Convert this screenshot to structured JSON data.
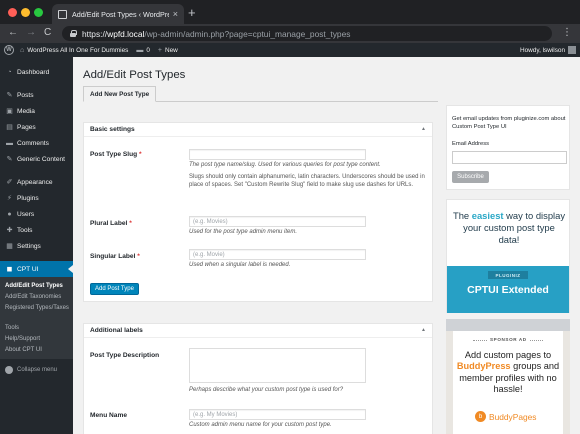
{
  "browser": {
    "tab_title": "Add/Edit Post Types ‹ WordPre…",
    "tab_close": "×",
    "new_tab": "+",
    "back": "←",
    "forward": "→",
    "reload": "C",
    "url_scheme": "https://",
    "url_host": "wpfd.local",
    "url_path": "/wp-admin/admin.php?page=cptui_manage_post_types",
    "menu": "⋮"
  },
  "adminbar": {
    "logo": "W",
    "site_name": "WordPress All In One For Dummies",
    "comments_count": "0",
    "new_label": "New",
    "howdy": "Howdy, lswilson"
  },
  "sidebar": {
    "items": [
      {
        "label": "Dashboard",
        "icon": "dashboard-icon",
        "glyph": "◔"
      },
      {
        "label": "Posts",
        "icon": "pin-icon",
        "glyph": "✎"
      },
      {
        "label": "Media",
        "icon": "media-icon",
        "glyph": "▣"
      },
      {
        "label": "Pages",
        "icon": "pages-icon",
        "glyph": "▤"
      },
      {
        "label": "Comments",
        "icon": "comments-icon",
        "glyph": "▬"
      },
      {
        "label": "Generic Content",
        "icon": "pin-icon",
        "glyph": "✎"
      },
      {
        "label": "Appearance",
        "icon": "brush-icon",
        "glyph": "✐"
      },
      {
        "label": "Plugins",
        "icon": "plug-icon",
        "glyph": "⚡"
      },
      {
        "label": "Users",
        "icon": "user-icon",
        "glyph": "●"
      },
      {
        "label": "Tools",
        "icon": "wrench-icon",
        "glyph": "✚"
      },
      {
        "label": "Settings",
        "icon": "settings-icon",
        "glyph": "▦"
      },
      {
        "label": "CPT UI",
        "icon": "cptui-icon",
        "glyph": "◼"
      }
    ],
    "submenu": [
      "Add/Edit Post Types",
      "Add/Edit Taxonomies",
      "Registered Types/Taxes",
      "Tools",
      "Help/Support",
      "About CPT UI"
    ],
    "collapse": "Collapse menu"
  },
  "main": {
    "title": "Add/Edit Post Types",
    "tab": "Add New Post Type",
    "basic": {
      "heading": "Basic settings",
      "toggle": "▲",
      "slug_label": "Post Type Slug",
      "required": "*",
      "slug_desc": "The post type name/slug. Used for various queries for post type content.",
      "slug_note": "Slugs should only contain alphanumeric, latin characters. Underscores should be used in place of spaces. Set \"Custom Rewrite Slug\" field to make slug use dashes for URLs.",
      "plural_label": "Plural Label",
      "plural_placeholder": "(e.g. Movies)",
      "plural_desc": "Used for the post type admin menu item.",
      "singular_label": "Singular Label",
      "singular_placeholder": "(e.g. Movie)",
      "singular_desc": "Used when a singular label is needed.",
      "add_button": "Add Post Type"
    },
    "additional": {
      "heading": "Additional labels",
      "toggle": "▲",
      "desc_label": "Post Type Description",
      "desc_help": "Perhaps describe what your custom post type is used for?",
      "menu_label": "Menu Name",
      "menu_placeholder": "(e.g. My Movies)",
      "menu_desc": "Custom admin menu name for your custom post type."
    }
  },
  "right": {
    "email_heading": "Get email updates from pluginize.com about Custom Post Type UI",
    "email_label": "Email Address",
    "subscribe": "Subscribe",
    "ad1_pre": "The ",
    "ad1_highlight": "easiest",
    "ad1_post": " way to display your custom post type data!",
    "ad1_badge": "PLUGINIZ",
    "ad1_title": "CPTUI Extended",
    "ad2_tag": "SPONSOR AD",
    "ad2_pre": "Add custom pages to ",
    "ad2_brand": "BuddyPress",
    "ad2_post": " groups and member profiles with no hassle!",
    "ad2_logo_glyph": "b",
    "ad2_logo": "BuddyPages"
  }
}
